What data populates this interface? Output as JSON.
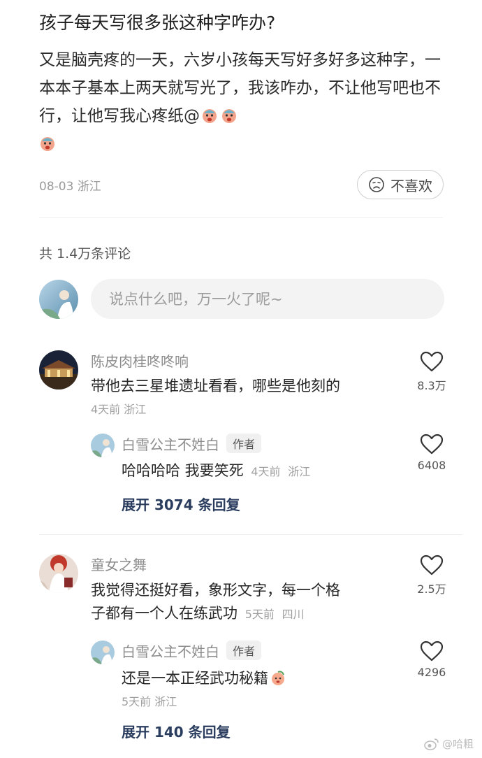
{
  "post": {
    "title": "孩子每天写很多张这种字咋办?",
    "body": "又是脑壳疼的一天，六岁小孩每天写好多好多这种字，一本本子基本上两天就写光了，我该咋办，不让他写吧也不行，让他写我心疼纸@",
    "date": "08-03",
    "location": "浙江",
    "dislike_label": "不喜欢",
    "emojis": [
      "crying-emoji",
      "crying-emoji",
      "crying-emoji"
    ]
  },
  "comments_header": {
    "count_label": "共 1.4万条评论"
  },
  "comment_box": {
    "placeholder": "说点什么吧，万一火了呢~"
  },
  "comments": [
    {
      "author": "陈皮肉桂咚咚响",
      "text": "带他去三星堆遗址看看，哪些是他刻的",
      "time": "4天前",
      "location": "浙江",
      "likes": "8.3万",
      "reply": {
        "author": "白雪公主不姓白",
        "badge": "作者",
        "text": "哈哈哈哈 我要笑死",
        "time": "4天前",
        "location": "浙江",
        "likes": "6408"
      },
      "expand_label": "展开 3074 条回复"
    },
    {
      "author": "童女之舞",
      "text_line1": "我觉得还挺好看，象形文字，每一个格",
      "text_line2": "子都有一个人在练武功",
      "time": "5天前",
      "location": "四川",
      "likes": "2.5万",
      "reply": {
        "author": "白雪公主不姓白",
        "badge": "作者",
        "text": "还是一本正经武功秘籍",
        "time": "5天前",
        "location": "浙江",
        "likes": "4296",
        "emoji": "peach-emoji"
      },
      "expand_label": "展开 140 条回复"
    }
  ],
  "watermark": {
    "text": "@哈粗",
    "icon": "weibo-icon"
  },
  "colors": {
    "link": "#2a3d5e",
    "muted": "#9a9a9a"
  }
}
